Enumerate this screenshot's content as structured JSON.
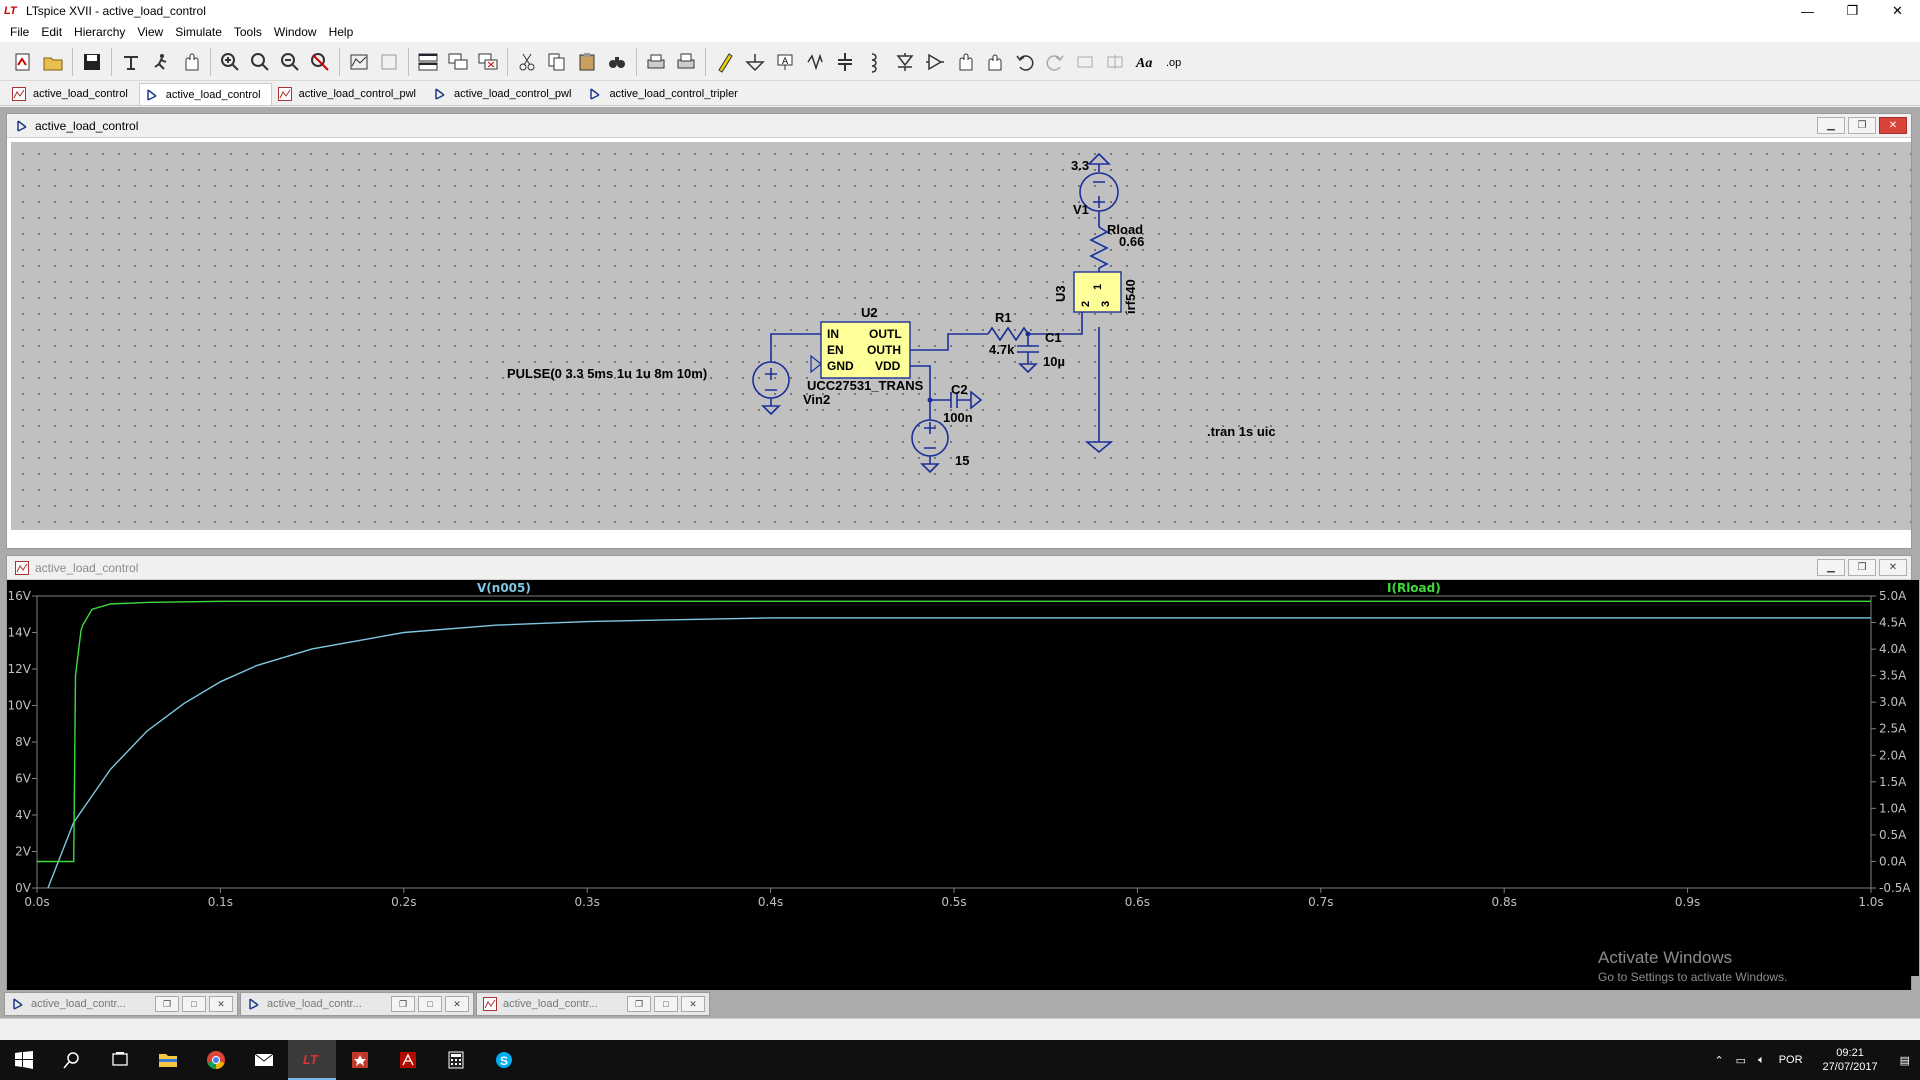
{
  "window": {
    "title": "LTspice XVII - active_load_control",
    "min": "—",
    "max": "❐",
    "close": "✕"
  },
  "menu": [
    "File",
    "Edit",
    "Hierarchy",
    "View",
    "Simulate",
    "Tools",
    "Window",
    "Help"
  ],
  "toolbar_icons": [
    "new-schematic-icon",
    "open-icon",
    "save-icon",
    "control-panel-icon",
    "run-icon",
    "halt-icon",
    "zoom-in-icon",
    "zoom-full-icon",
    "zoom-out-icon",
    "zoom-cancel-icon",
    "autorange-icon",
    "zoom-back-icon",
    "tile-horizontal-icon",
    "cascade-icon",
    "close-windows-icon",
    "cut-icon",
    "copy-icon",
    "paste-icon",
    "find-icon",
    "print-icon",
    "print-setup-icon",
    "draw-wire-icon",
    "ground-icon",
    "label-net-icon",
    "resistor-icon",
    "capacitor-icon",
    "inductor-icon",
    "diode-icon",
    "component-icon",
    "move-icon",
    "drag-icon",
    "undo-icon",
    "redo-icon",
    "rotate-icon",
    "mirror-icon",
    "text-icon",
    "spice-directive-icon"
  ],
  "tabs": [
    {
      "label": "active_load_control",
      "kind": "waveform"
    },
    {
      "label": "active_load_control",
      "kind": "schematic",
      "active": true
    },
    {
      "label": "active_load_control_pwl",
      "kind": "waveform"
    },
    {
      "label": "active_load_control_pwl",
      "kind": "schematic"
    },
    {
      "label": "active_load_control_tripler",
      "kind": "schematic"
    }
  ],
  "schematic_window": {
    "title": "active_load_control",
    "labels": {
      "v1_value": "3.3",
      "v1_name": "V1",
      "rload_name": "Rload",
      "rload_value": "0.66",
      "u3_name": "U3",
      "u3_model": "irf540",
      "u3_pin1": "1",
      "u3_pin2": "2",
      "u3_pin3": "3",
      "u2_name": "U2",
      "u2_model": "UCC27531_TRANS",
      "u2_pin_in": "IN",
      "u2_pin_en": "EN",
      "u2_pin_gnd": "GND",
      "u2_pin_outl": "OUTL",
      "u2_pin_outh": "OUTH",
      "u2_pin_vdd": "VDD",
      "r1_name": "R1",
      "r1_value": "4.7k",
      "c1_name": "C1",
      "c1_value": "10µ",
      "c2_name": "C2",
      "c2_value": "100n",
      "vin2_name": "Vin2",
      "vin2_value": "PULSE(0 3.3 5ms 1u 1u 8m 10m)",
      "vdd_value": "15",
      "tran_directive": ".tran 1s uic"
    }
  },
  "plot_window": {
    "title": "active_load_control",
    "trace1": {
      "name": "V(n005)",
      "color": "#7ec8e3"
    },
    "trace2": {
      "name": "I(Rload)",
      "color": "#3ddc3d"
    },
    "left_ticks": [
      "16V",
      "14V",
      "12V",
      "10V",
      "8V",
      "6V",
      "4V",
      "2V",
      "0V"
    ],
    "right_ticks": [
      "5.0A",
      "4.5A",
      "4.0A",
      "3.5A",
      "3.0A",
      "2.5A",
      "2.0A",
      "1.5A",
      "1.0A",
      "0.5A",
      "0.0A",
      "-0.5A"
    ],
    "x_ticks": [
      "0.0s",
      "0.1s",
      "0.2s",
      "0.3s",
      "0.4s",
      "0.5s",
      "0.6s",
      "0.7s",
      "0.8s",
      "0.9s",
      "1.0s"
    ]
  },
  "chart_data": {
    "type": "line",
    "title": "",
    "xlabel": "",
    "ylabel": "",
    "xlim": [
      0,
      1.0
    ],
    "ylim": [
      0,
      16
    ],
    "y2lim": [
      -0.5,
      5.0
    ],
    "grid": false,
    "series": [
      {
        "name": "V(n005)",
        "axis": "left",
        "x": [
          0.006,
          0.02,
          0.04,
          0.06,
          0.08,
          0.1,
          0.12,
          0.15,
          0.2,
          0.25,
          0.3,
          0.35,
          0.4,
          0.5,
          0.6,
          0.8,
          1.0
        ],
        "values": [
          0,
          3.6,
          6.5,
          8.6,
          10.1,
          11.3,
          12.2,
          13.1,
          14.0,
          14.4,
          14.6,
          14.7,
          14.8,
          14.8,
          14.8,
          14.8,
          14.8
        ]
      },
      {
        "name": "I(Rload)",
        "axis": "right",
        "x": [
          0,
          0.02,
          0.021,
          0.024,
          0.025,
          0.03,
          0.04,
          0.06,
          0.1,
          1.0
        ],
        "values": [
          0.0,
          0.0,
          3.5,
          4.35,
          4.45,
          4.75,
          4.85,
          4.88,
          4.9,
          4.9
        ]
      }
    ]
  },
  "minimized": [
    {
      "label": "active_load_contr...",
      "kind": "schematic"
    },
    {
      "label": "active_load_contr...",
      "kind": "schematic"
    },
    {
      "label": "active_load_contr...",
      "kind": "waveform"
    }
  ],
  "watermark": {
    "title": "Activate Windows",
    "sub": "Go to Settings to activate Windows."
  },
  "taskbar": {
    "icons": [
      "start-icon",
      "search-icon",
      "task-view-icon",
      "file-explorer-icon",
      "chrome-icon",
      "mail-icon",
      "ltspice-icon",
      "app-icon",
      "acrobat-icon",
      "calculator-icon",
      "skype-icon"
    ],
    "lang": "POR",
    "time": "09:21",
    "date": "27/07/2017"
  }
}
